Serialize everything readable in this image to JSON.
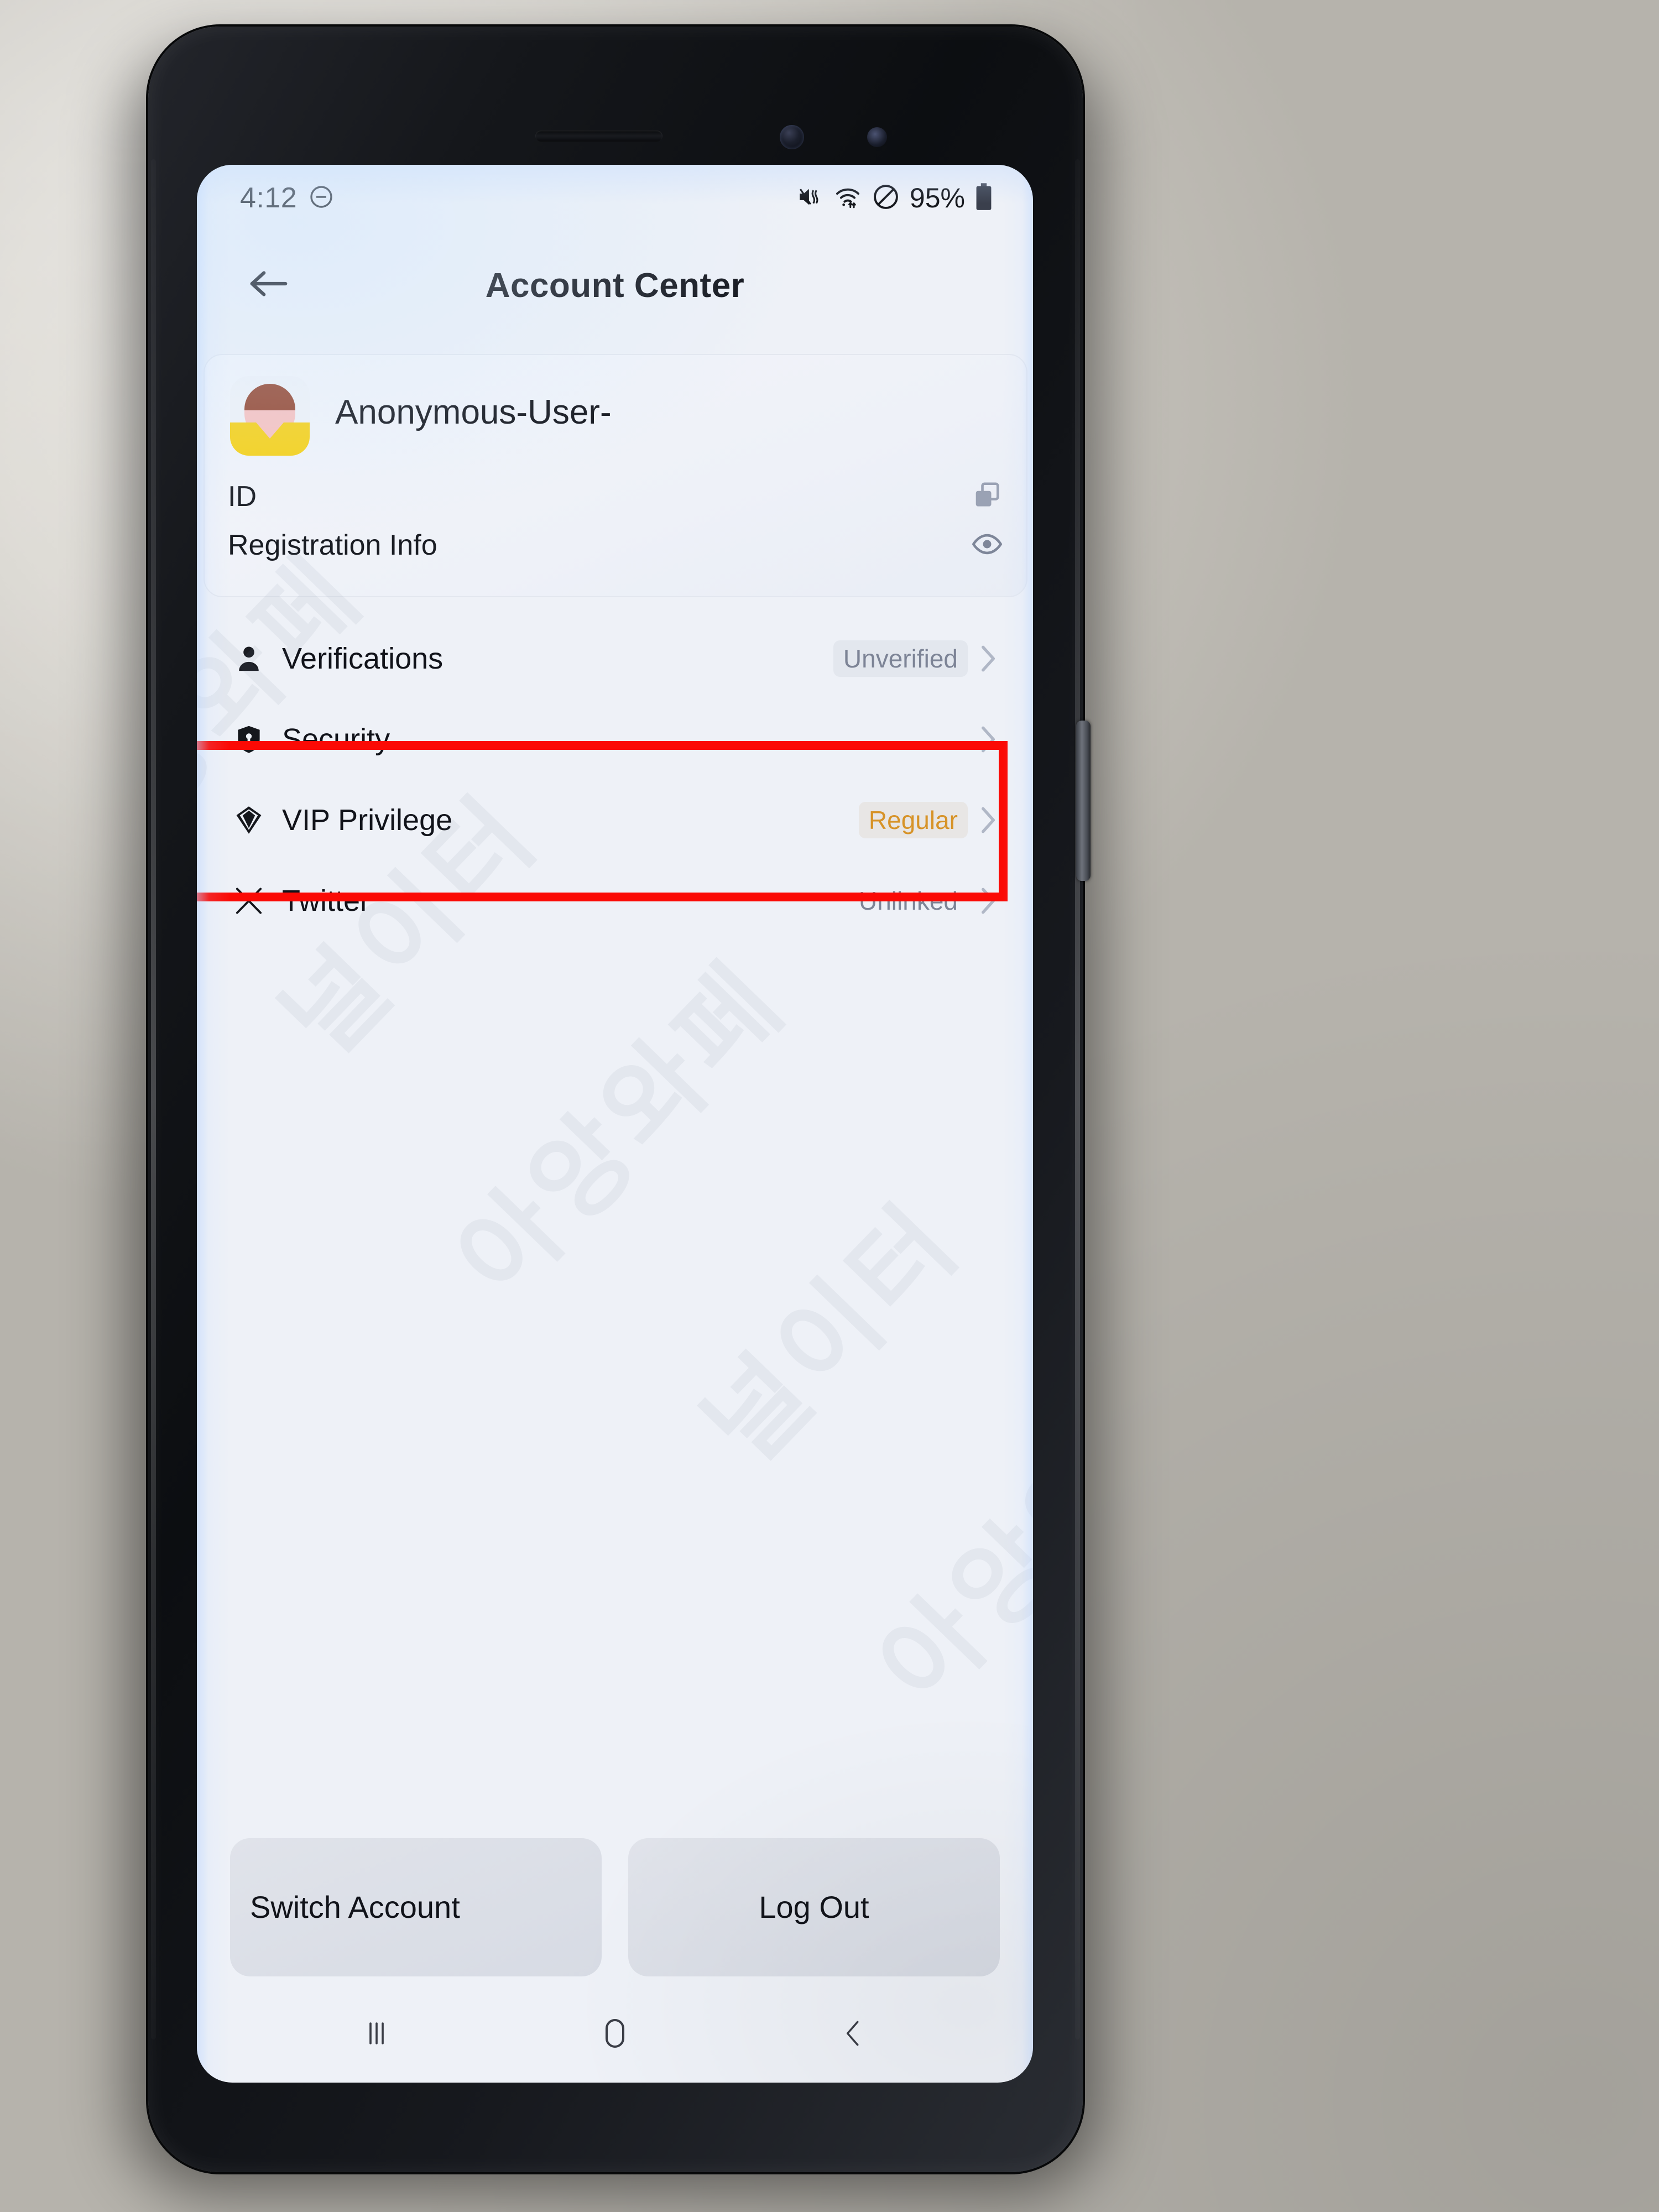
{
  "statusbar": {
    "clock": "4:12",
    "battery_percent": "95%",
    "icons": [
      "minus-circle-icon",
      "mute-vibrate-icon",
      "wifi-icon",
      "do-not-disturb-icon",
      "battery-icon"
    ]
  },
  "header": {
    "title": "Account Center",
    "back_label": "←"
  },
  "profile": {
    "name": "Anonymous-User-",
    "rows": [
      {
        "label": "ID",
        "icon": "copy-icon"
      },
      {
        "label": "Registration Info",
        "icon": "eye-icon"
      }
    ]
  },
  "menu": {
    "items": [
      {
        "label": "Verifications",
        "icon": "person-icon",
        "status": "Unverified",
        "status_style": "pill",
        "highlighted": false
      },
      {
        "label": "Security",
        "icon": "shield-icon",
        "status": "",
        "status_style": "none",
        "highlighted": true
      },
      {
        "label": "VIP Privilege",
        "icon": "diamond-icon",
        "status": "Regular",
        "status_style": "gold",
        "highlighted": false
      },
      {
        "label": "Twitter",
        "icon": "x-twitter-icon",
        "status": "Unlinked",
        "status_style": "none",
        "highlighted": false
      }
    ]
  },
  "actions": {
    "switch_account": "Switch Account",
    "log_out": "Log Out"
  },
  "navbar": {
    "recents": "recents-icon",
    "home": "home-icon",
    "back": "back-icon"
  },
  "annotation": {
    "color": "#fb0a05",
    "target": "Security"
  },
  "watermark": {
    "lines": [
      "아앙와페",
      "널이터",
      "아앙와페",
      "널이터",
      "아앙와페"
    ]
  },
  "colors": {
    "accent_gold": "#d79328",
    "annotation_red": "#fb0a05",
    "screen_bg": "#eef1f7",
    "avatar_hair": "#95462f",
    "avatar_face": "#f8c2c0",
    "avatar_shirt": "#f7d117"
  }
}
